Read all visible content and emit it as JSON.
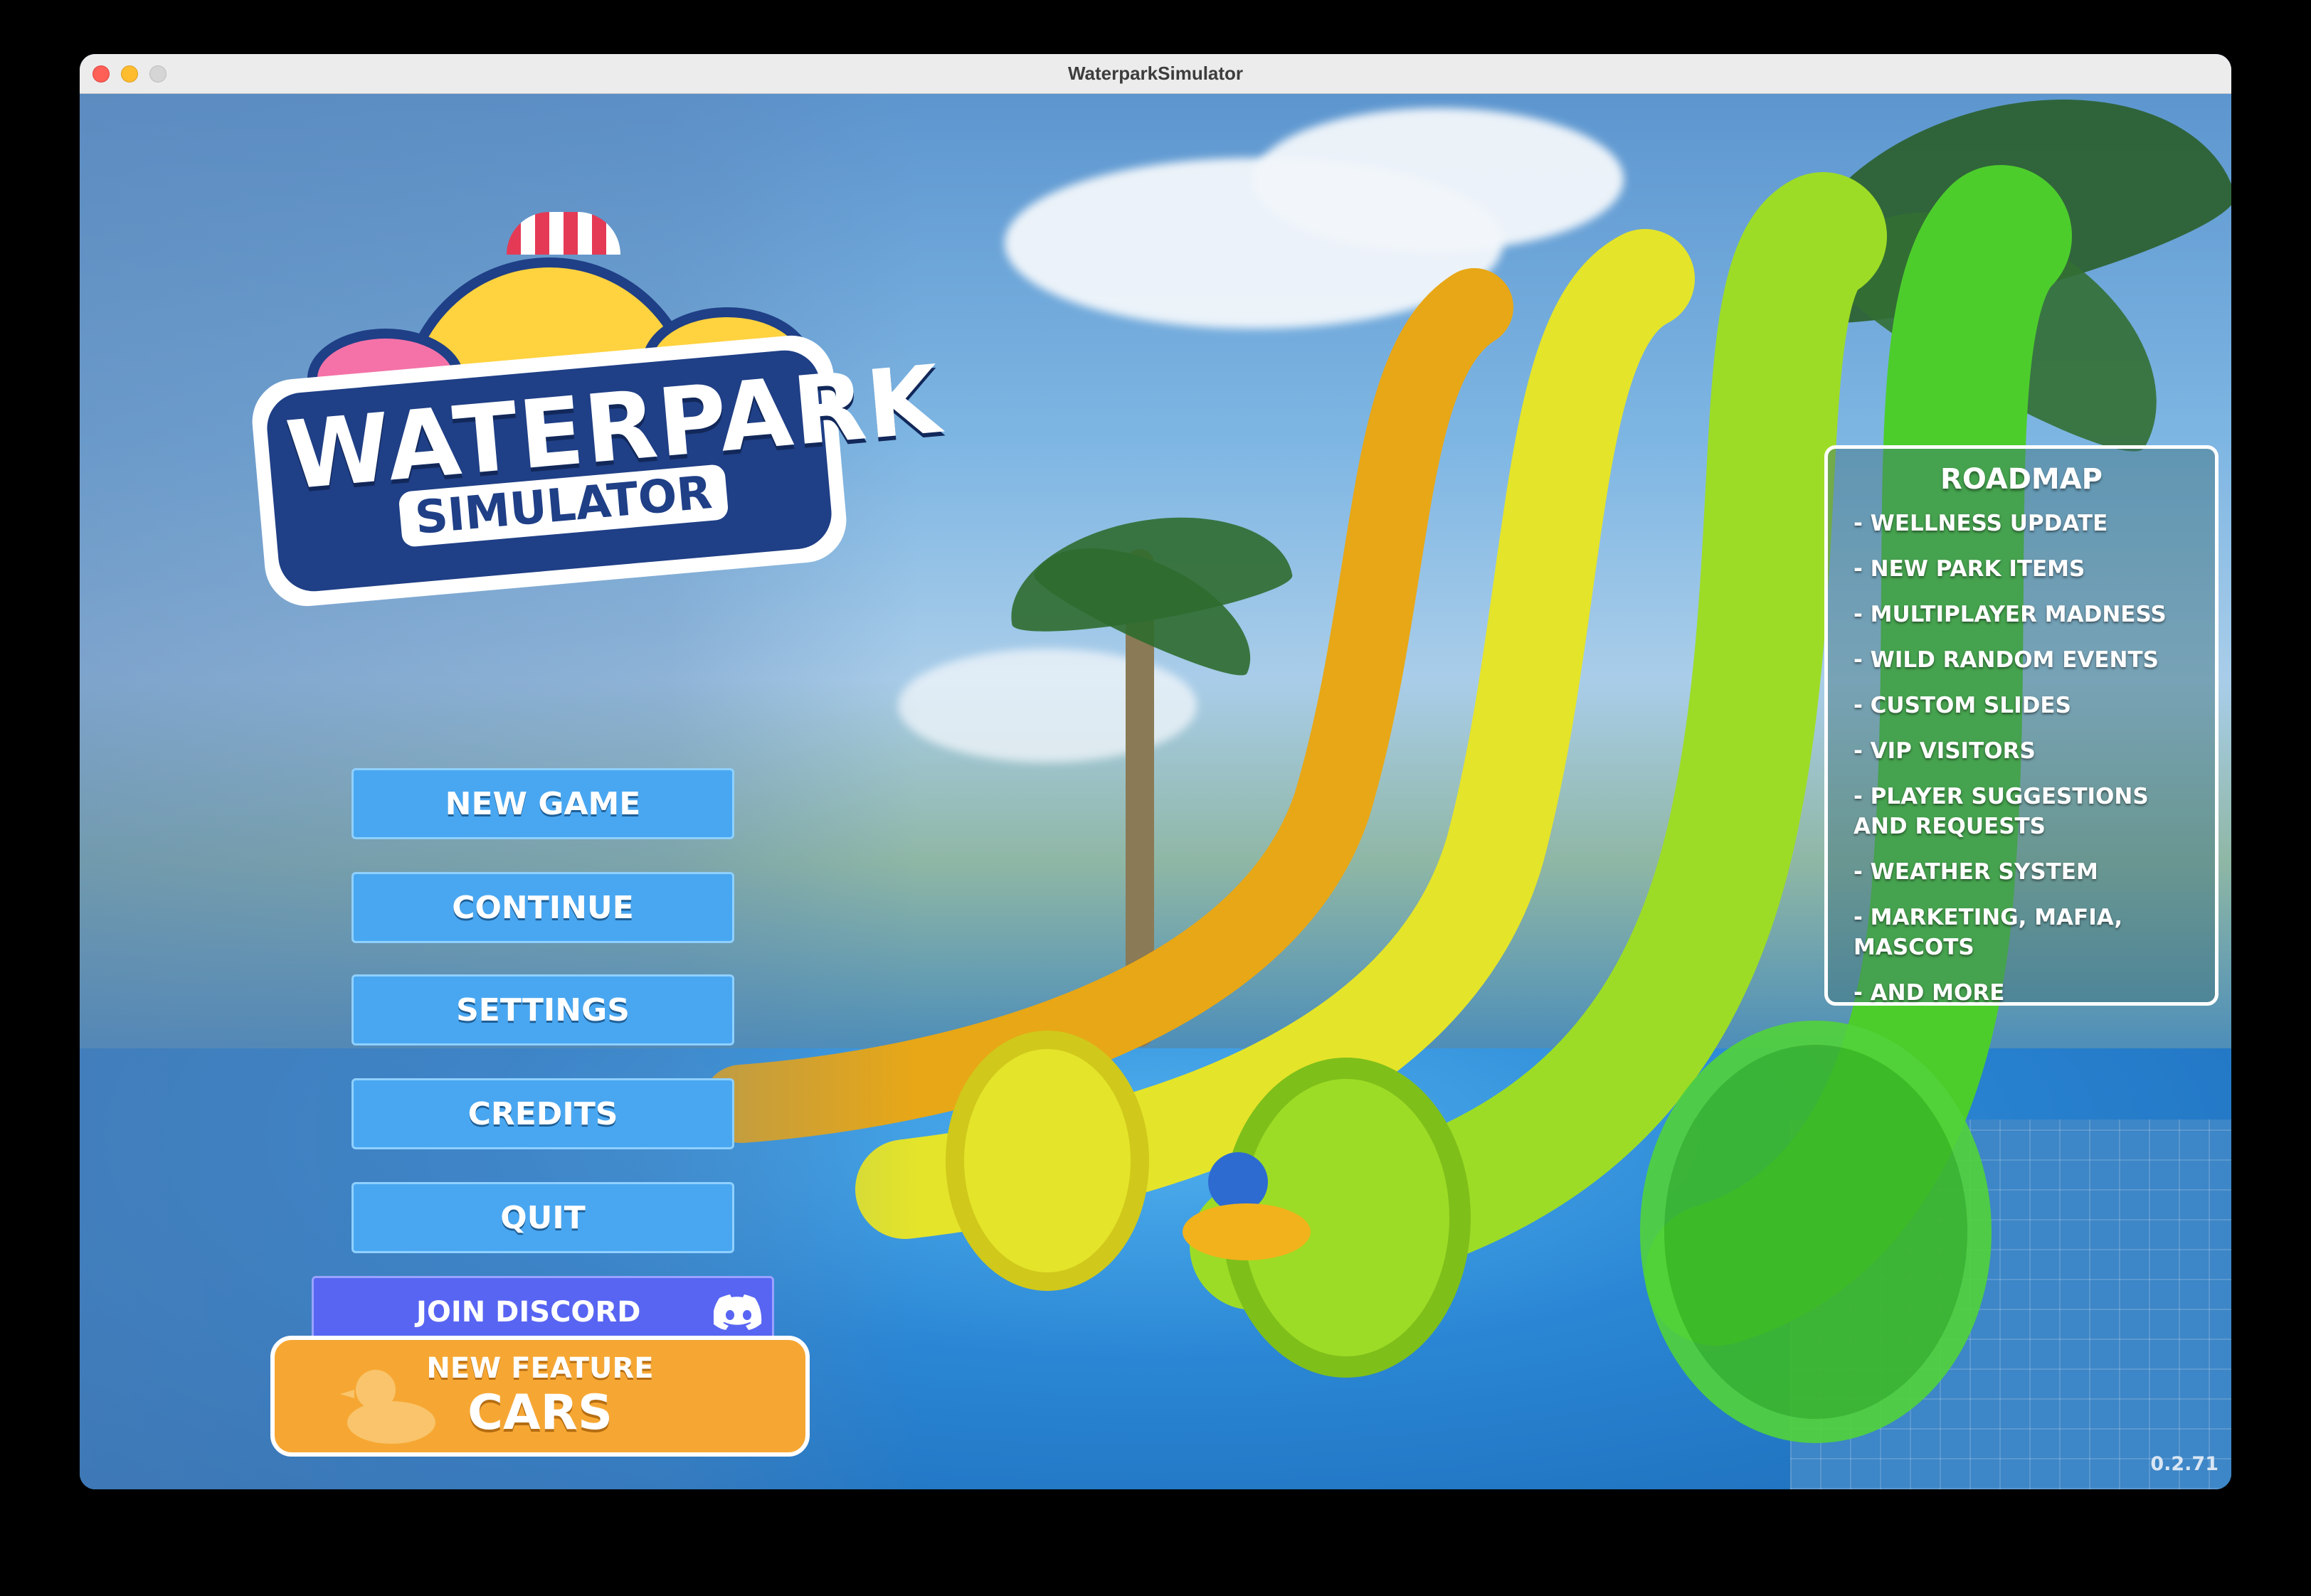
{
  "window": {
    "title": "WaterparkSimulator"
  },
  "logo": {
    "line1": "WATERPARK",
    "line2": "SIMULATOR"
  },
  "menu": {
    "new_game": "NEW GAME",
    "continue": "CONTINUE",
    "settings": "SETTINGS",
    "credits": "CREDITS",
    "quit": "QUIT"
  },
  "discord": {
    "label": "JOIN DISCORD",
    "color": "#5865f2"
  },
  "feature": {
    "sub": "NEW FEATURE",
    "main": "CARS",
    "color": "#f6a733"
  },
  "roadmap": {
    "title": "ROADMAP",
    "items": [
      "- WELLNESS UPDATE",
      "- NEW PARK ITEMS",
      "- MULTIPLAYER MADNESS",
      "- WILD RANDOM EVENTS",
      "- CUSTOM SLIDES",
      "- VIP VISITORS",
      "- PLAYER SUGGESTIONS AND REQUESTS",
      "- WEATHER SYSTEM",
      "- MARKETING, MAFIA, MASCOTS",
      "- AND MORE"
    ]
  },
  "version": "0.2.71",
  "colors": {
    "button": "#49a7f1",
    "slide_orange": "#f2b21c",
    "slide_yellow": "#e8e82c",
    "slide_green": "#8bd92b"
  }
}
